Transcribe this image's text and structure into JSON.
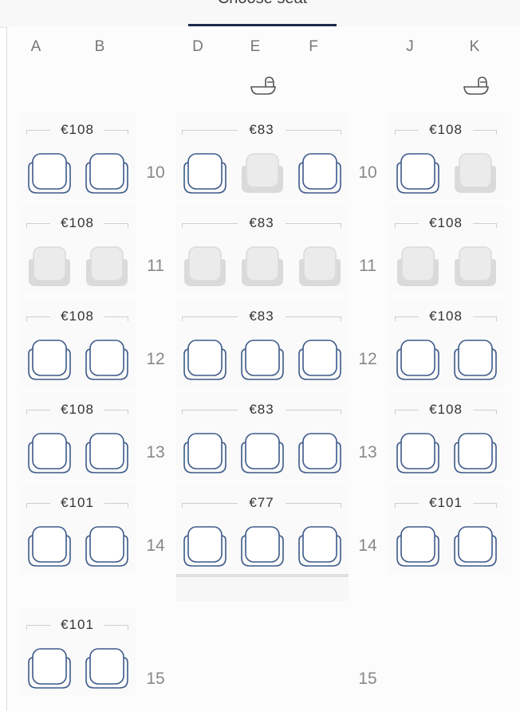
{
  "header": {
    "tab_label": "Choose seat"
  },
  "columns": [
    "A",
    "B",
    "D",
    "E",
    "F",
    "J",
    "K"
  ],
  "rows": [
    {
      "number": "10",
      "prices": {
        "left": "€108",
        "middle": "€83",
        "right": "€108"
      },
      "seats": {
        "A": "available",
        "B": "available",
        "D": "available",
        "E": "occupied",
        "F": "available",
        "J": "available",
        "K": "occupied"
      }
    },
    {
      "number": "11",
      "prices": {
        "left": "€108",
        "middle": "€83",
        "right": "€108"
      },
      "seats": {
        "A": "occupied",
        "B": "occupied",
        "D": "occupied",
        "E": "occupied",
        "F": "occupied",
        "J": "occupied",
        "K": "occupied"
      }
    },
    {
      "number": "12",
      "prices": {
        "left": "€108",
        "middle": "€83",
        "right": "€108"
      },
      "seats": {
        "A": "available",
        "B": "available",
        "D": "available",
        "E": "available",
        "F": "available",
        "J": "available",
        "K": "available"
      }
    },
    {
      "number": "13",
      "prices": {
        "left": "€108",
        "middle": "€83",
        "right": "€108"
      },
      "seats": {
        "A": "available",
        "B": "available",
        "D": "available",
        "E": "available",
        "F": "available",
        "J": "available",
        "K": "available"
      }
    },
    {
      "number": "14",
      "prices": {
        "left": "€101",
        "middle": "€77",
        "right": "€101"
      },
      "seats": {
        "A": "available",
        "B": "available",
        "D": "available",
        "E": "available",
        "F": "available",
        "J": "available",
        "K": "available"
      }
    },
    {
      "number": "15",
      "prices": {
        "left": "€101"
      },
      "seats": {
        "A": "available",
        "B": "available"
      }
    }
  ],
  "icons": {
    "bassinet": "bassinet-icon"
  },
  "colors": {
    "available_outline": "#3d5a8a",
    "occupied_fill": "#ebebeb",
    "occupied_outline": "#dadada",
    "accent": "#1a2b4c"
  }
}
